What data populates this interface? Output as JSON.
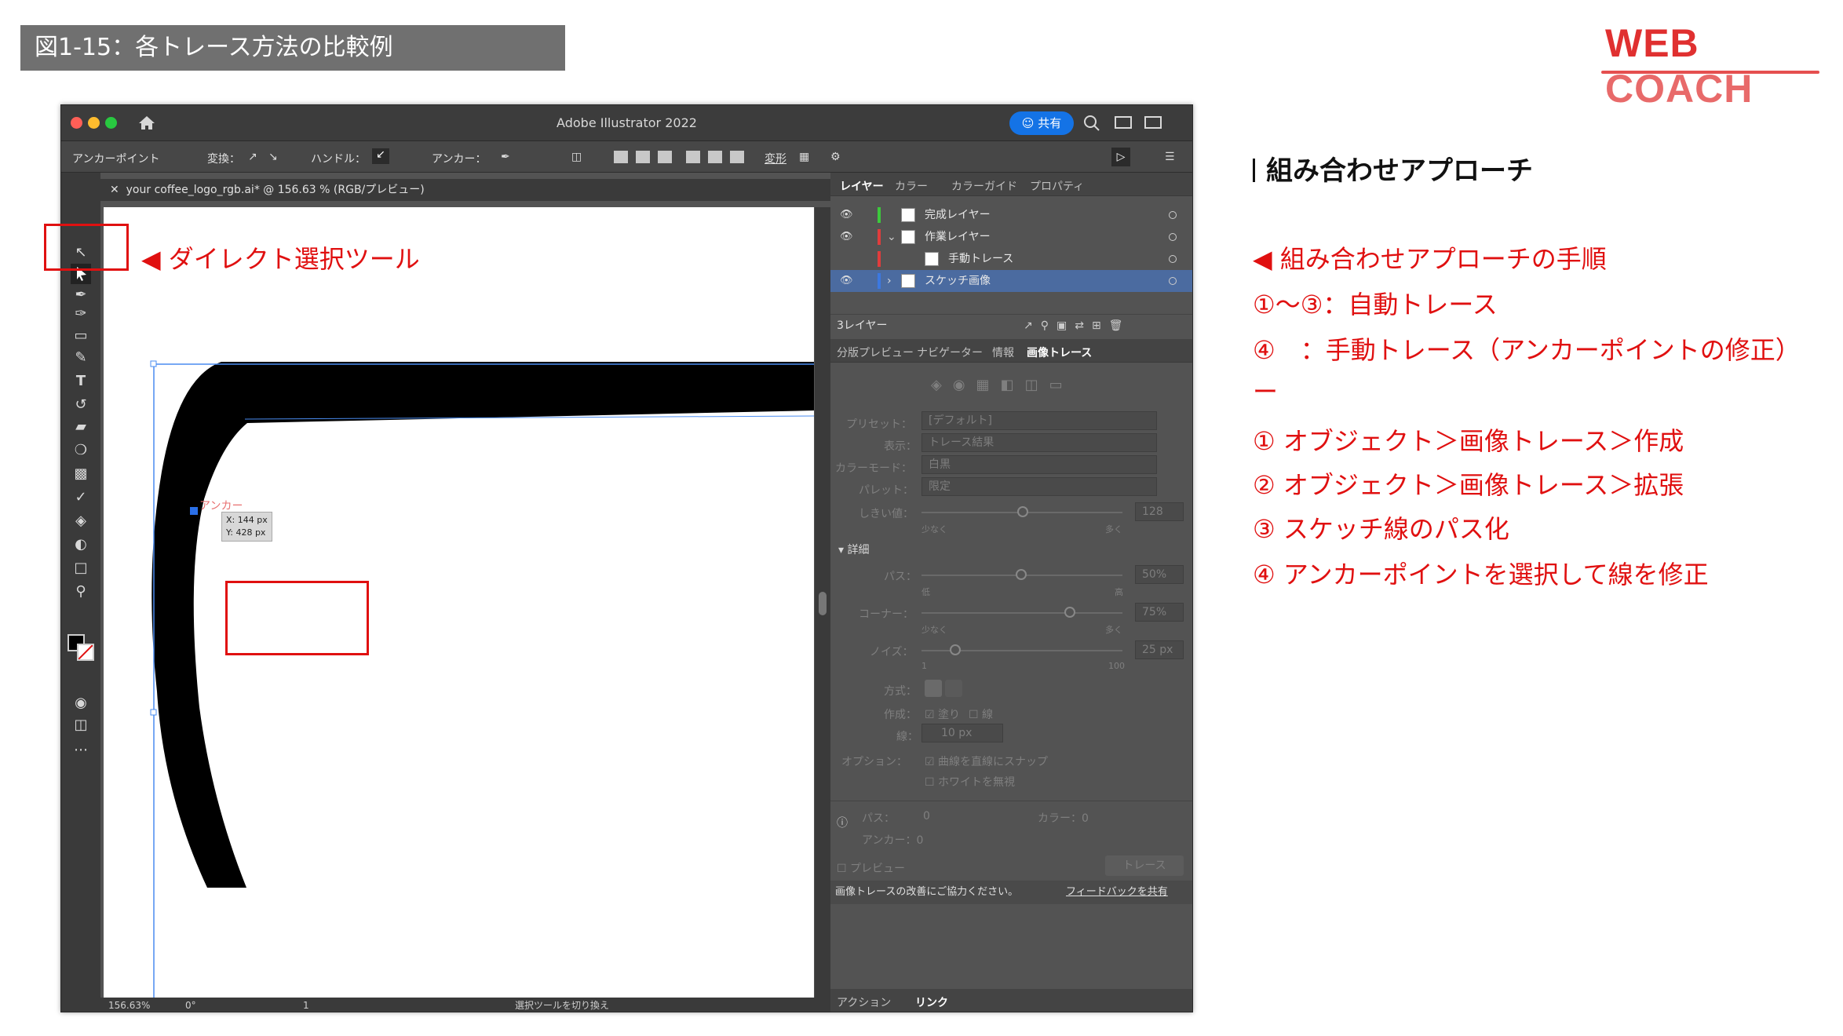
{
  "figure_title": "図1-15：各トレース方法の比較例",
  "logo": {
    "part1": "WEB",
    "part2": "COACH"
  },
  "window": {
    "title": "Adobe Illustrator 2022",
    "share_label": "共有",
    "control_bar": {
      "mode": "アンカーポイント",
      "convert": "変換：",
      "handle": "ハンドル：",
      "anchor": "アンカー：",
      "transform": "変形"
    },
    "document_tab": "your coffee_logo_rgb.ai* @ 156.63 % (RGB/プレビュー)",
    "status": {
      "zoom": "156.63%",
      "rotation": "0°",
      "page": "1",
      "tool_hint": "選択ツールを切り換え"
    }
  },
  "canvas": {
    "anchor_label": "アンカー",
    "tooltip_x": "X: 144 px",
    "tooltip_y": "Y: 428 px"
  },
  "annotation": {
    "direct_select": "◀ ダイレクト選択ツール"
  },
  "layers_panel": {
    "tabs": [
      "レイヤー",
      "カラー",
      "カラーガイド",
      "プロパティ"
    ],
    "rows": [
      {
        "name": "完成レイヤー",
        "color": "#3cc83c"
      },
      {
        "name": "作業レイヤー",
        "color": "#e03c3c"
      },
      {
        "name": "手動トレース",
        "color": "#e03c3c"
      },
      {
        "name": "スケッチ画像",
        "color": "#3c78e0"
      }
    ],
    "count": "3レイヤー"
  },
  "trace_panel": {
    "tabs": [
      "分版プレビュー",
      "ナビゲーター",
      "情報",
      "画像トレース"
    ],
    "preset_label": "プリセット：",
    "preset_value": "[デフォルト]",
    "view_label": "表示：",
    "view_value": "トレース結果",
    "mode_label": "カラーモード：",
    "mode_value": "白黒",
    "palette_label": "パレット：",
    "palette_value": "限定",
    "threshold_label": "しきい値：",
    "threshold_value": "128",
    "less": "少なく",
    "more": "多く",
    "advanced": "詳細",
    "paths_label": "パス：",
    "paths_value": "50%",
    "low": "低",
    "high": "高",
    "corners_label": "コーナー：",
    "corners_value": "75%",
    "noise_label": "ノイズ：",
    "noise_value": "25 px",
    "noise_min": "1",
    "noise_max": "100",
    "method_label": "方式：",
    "create_label": "作成：",
    "fill": "塗り",
    "stroke": "線",
    "stroke_label": "線：",
    "stroke_value": "10 px",
    "options_label": "オプション：",
    "snap": "曲線を直線にスナップ",
    "ignore_white": "ホワイトを無視",
    "stat_paths": "パス：",
    "stat_paths_val": "0",
    "stat_anchors": "アンカー：0",
    "stat_colors": "カラー：0",
    "preview": "プレビュー",
    "trace_button": "トレース",
    "feedback": "画像トレースの改善にご協力ください。",
    "feedback_link": "フィードバックを共有",
    "bottom_tabs": [
      "アクション",
      "リンク"
    ]
  },
  "right_column": {
    "heading": "組み合わせアプローチ",
    "steps_title": "◀ 組み合わせアプローチの手順",
    "line1": "①〜③：自動トレース",
    "line2": "④　：手動トレース（アンカーポイントの修正）",
    "dash": "ー",
    "step1": "① オブジェクト＞画像トレース＞作成",
    "step2": "② オブジェクト＞画像トレース＞拡張",
    "step3": "③ スケッチ線のパス化",
    "step4": "④ アンカーポイントを選択して線を修正"
  }
}
